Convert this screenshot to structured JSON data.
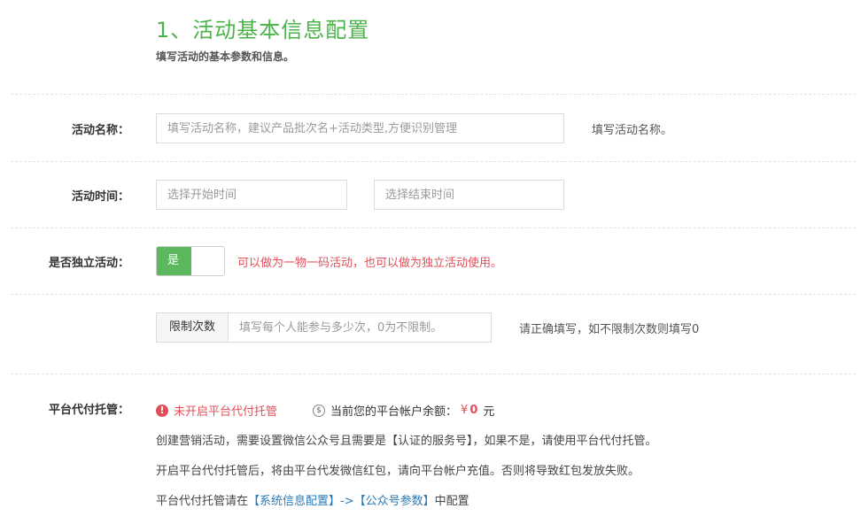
{
  "section": {
    "title": "1、活动基本信息配置",
    "subtitle": "填写活动的基本参数和信息。"
  },
  "form": {
    "name": {
      "label": "活动名称：",
      "placeholder": "填写活动名称，建议产品批次名+活动类型,方便识别管理",
      "help": "填写活动名称。"
    },
    "time": {
      "label": "活动时间：",
      "start_placeholder": "选择开始时间",
      "end_placeholder": "选择结束时间"
    },
    "independent": {
      "label": "是否独立活动：",
      "toggle_label": "是",
      "toggle_on": true,
      "hint": "可以做为一物一码活动，也可以做为独立活动使用。"
    },
    "limit": {
      "addon": "限制次数",
      "placeholder": "填写每个人能参与多少次，0为不限制。",
      "help": "请正确填写，如不限制次数则填写0"
    },
    "escrow": {
      "label": "平台代付托管：",
      "status_icon": "alert-circle-icon",
      "status_text": "未开启平台代付托管",
      "balance_icon": "dollar-coin-icon",
      "balance_label": "当前您的平台帐户余额：",
      "currency_symbol": "¥",
      "balance_value": "0",
      "unit": "元",
      "note1": "创建营销活动，需要设置微信公众号且需要是【认证的服务号】，如果不是，请使用平台代付托管。",
      "note2": "开启平台代付托管后，将由平台代发微信红包，请向平台帐户充值。否则将导致红包发放失败。",
      "note3_prefix": "平台代付托管请在",
      "note3_link1": "【系统信息配置】",
      "note3_arrow": "->",
      "note3_link2": "【公众号参数】",
      "note3_suffix": "中配置"
    }
  },
  "colors": {
    "accent": "#4cb34a",
    "toggle_on": "#5cb85c",
    "warning": "#e0505a",
    "link": "#2a7ab8"
  }
}
